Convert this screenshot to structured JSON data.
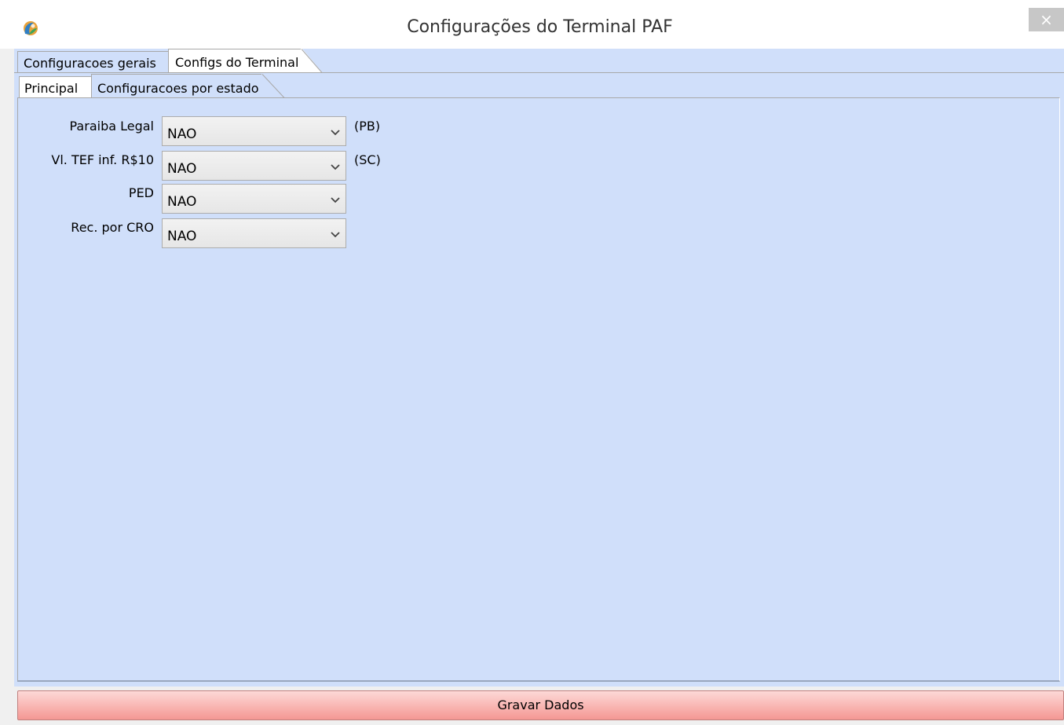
{
  "window": {
    "title": "Configurações do Terminal PAF",
    "close_glyph": "×",
    "icon": "app-logo-icon"
  },
  "outer_tabs": [
    {
      "label": "Configuracoes gerais",
      "selected": true
    },
    {
      "label": "Configs do Terminal",
      "selected": false
    }
  ],
  "inner_tabs": [
    {
      "label": "Principal",
      "selected": false
    },
    {
      "label": "Configuracoes por estado",
      "selected": true
    }
  ],
  "form": {
    "fields": [
      {
        "label": "Paraiba Legal",
        "value": "NAO",
        "suffix": "(PB)"
      },
      {
        "label": "Vl. TEF inf. R$10",
        "value": "NAO",
        "suffix": "(SC)"
      },
      {
        "label": "PED",
        "value": "NAO",
        "suffix": ""
      },
      {
        "label": "Rec. por CRO",
        "value": "NAO",
        "suffix": ""
      }
    ]
  },
  "actions": {
    "save_label": "Gravar Dados"
  },
  "colors": {
    "panel_background": "#d0dffa",
    "save_button": "#f9b8b5",
    "close_button": "#c7c7c7"
  }
}
